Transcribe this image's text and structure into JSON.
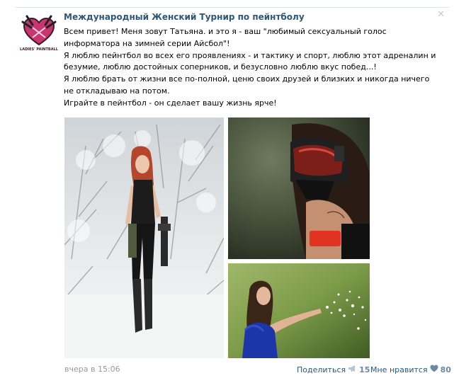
{
  "post": {
    "author": "Международный Женский Турнир по пейнтболу",
    "avatar_logo_text": "LADIES' PAINTBALL",
    "paragraphs": [
      "Всем привет! Меня зовут Татьяна. и это я - ваш \"любимый сексуальный голос информатора на зимней серии Айсбол\"!",
      "Я люблю пейнтбол во всех его проявлениях - и тактику и спорт, люблю этот адреналин и безумие, люблю достойных соперников, и безусловно люблю вкус побед...!",
      "Я люблю брать от жизни все по-полной, ценю своих друзей и близких и никогда ничего не откладываю на потом.",
      "Играйте в пейнтбол - он сделает вашу жизнь ярче!"
    ],
    "photos": [
      "photo-woman-snow",
      "photo-paintball-mask",
      "photo-woman-blowing-snow"
    ],
    "date": "вчера в 15:06",
    "share_label": "Поделиться",
    "share_count": "15",
    "like_label": "Мне нравится",
    "like_count": "80",
    "close_glyph": "✕"
  },
  "colors": {
    "link": "#2b587a",
    "muted": "#999999",
    "counter": "#6e87a3",
    "avatar_pink": "#c8356f"
  },
  "icons": {
    "share": "megaphone-icon",
    "like": "heart-icon",
    "close": "close-icon"
  }
}
